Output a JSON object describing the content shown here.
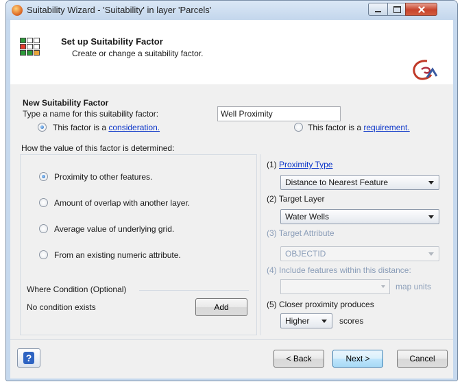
{
  "window": {
    "title": "Suitability Wizard - 'Suitability' in layer 'Parcels'"
  },
  "header": {
    "title": "Set up Suitability Factor",
    "subtitle": "Create or change a suitability factor."
  },
  "factor": {
    "section_title": "New Suitability Factor",
    "name_label": "Type a name for this suitability factor:",
    "name_value": "Well Proximity",
    "type_consideration_prefix": "This factor is a ",
    "type_consideration_link": "consideration.",
    "type_requirement_prefix": "This factor is a ",
    "type_requirement_link": "requirement.",
    "selected_type": "consideration"
  },
  "determination": {
    "legend": "How the value of this factor is determined:",
    "options": [
      {
        "label": "Proximity to other features.",
        "selected": true
      },
      {
        "label": "Amount of overlap with another layer.",
        "selected": false
      },
      {
        "label": "Average value of underlying grid.",
        "selected": false
      },
      {
        "label": "From an existing numeric attribute.",
        "selected": false
      }
    ]
  },
  "where": {
    "legend": "Where Condition (Optional)",
    "status": "No condition exists",
    "add_label": "Add"
  },
  "settings": {
    "proximity_prefix": "(1) ",
    "proximity_link": "Proximity Type",
    "proximity_value": "Distance to Nearest Feature",
    "target_layer_label": "(2) Target Layer",
    "target_layer_value": "Water Wells",
    "target_attribute_label": "(3) Target Attribute",
    "target_attribute_value": "OBJECTID",
    "include_label": "(4) Include features within this distance:",
    "map_units_label": "map units",
    "closer_label": "(5) Closer proximity produces",
    "closer_value": "Higher",
    "scores_label": "scores"
  },
  "footer": {
    "help_glyph": "?",
    "back_label": "< Back",
    "next_label": "Next >",
    "cancel_label": "Cancel"
  }
}
